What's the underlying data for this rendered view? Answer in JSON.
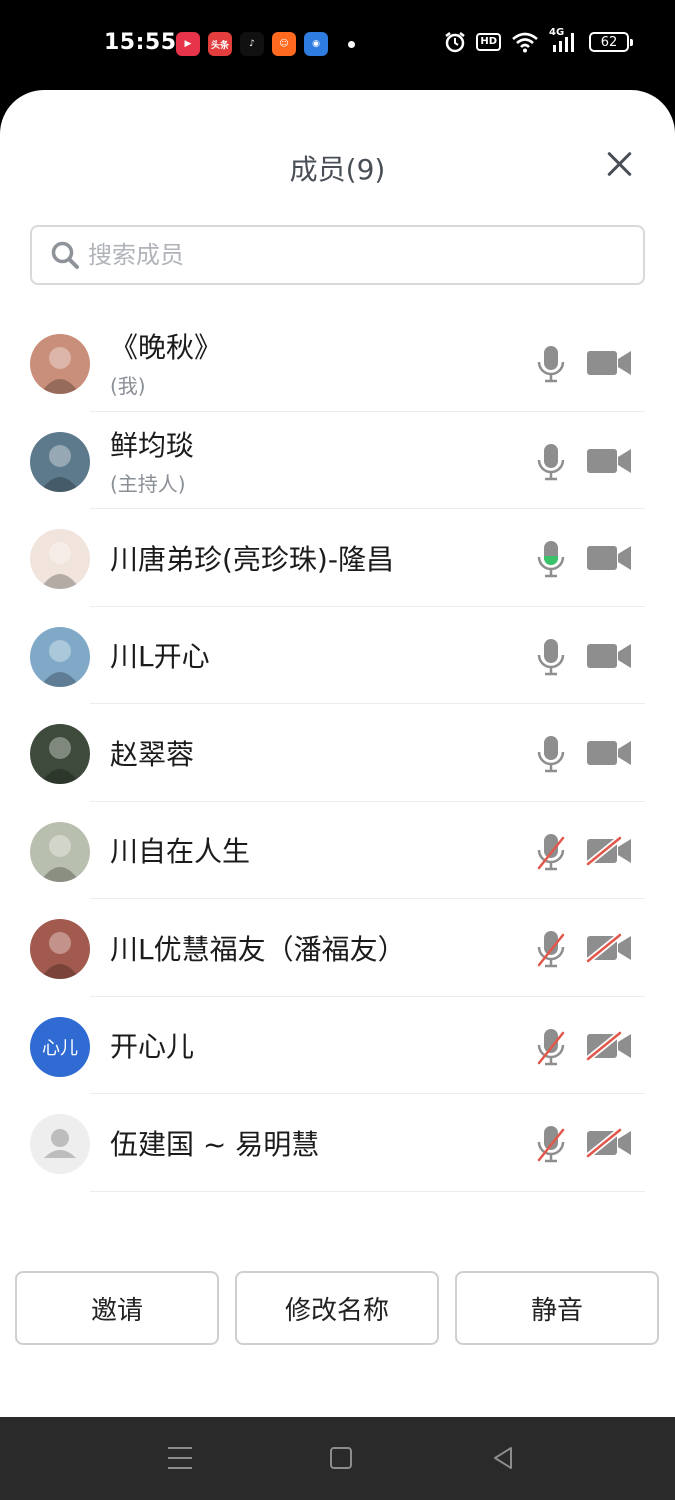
{
  "status_bar": {
    "time": "15:55",
    "apps": [
      {
        "name": "video-app-icon",
        "color": "#e8344a",
        "glyph": "▶"
      },
      {
        "name": "toutiao-app-icon",
        "color": "#e33e3e",
        "glyph": "头条"
      },
      {
        "name": "tiktok-app-icon",
        "color": "#111111",
        "glyph": "♪"
      },
      {
        "name": "kuaishou-app-icon",
        "color": "#ff6a1f",
        "glyph": "☺"
      },
      {
        "name": "meeting-app-icon",
        "color": "#2f7ce0",
        "glyph": "◉"
      }
    ],
    "hd": "HD",
    "network": "4G",
    "battery": "62"
  },
  "sheet": {
    "title": "成员(9)",
    "search_placeholder": "搜索成员"
  },
  "members": [
    {
      "name": "《晚秋》",
      "role": "(我)",
      "avatar": "photo",
      "avatar_color": "#c98f7a",
      "mic": "on",
      "cam": "on"
    },
    {
      "name": "鲜均琰",
      "role": "(主持人)",
      "avatar": "photo",
      "avatar_color": "#5d7a8c",
      "mic": "on",
      "cam": "on"
    },
    {
      "name": "川唐弟珍(亮珍珠)-隆昌",
      "role": "",
      "avatar": "photo",
      "avatar_color": "#f1e4dd",
      "mic": "speaking",
      "cam": "on"
    },
    {
      "name": "川L开心",
      "role": "",
      "avatar": "photo",
      "avatar_color": "#7fa9c7",
      "mic": "on",
      "cam": "on"
    },
    {
      "name": "赵翠蓉",
      "role": "",
      "avatar": "photo",
      "avatar_color": "#3e4a3b",
      "mic": "on",
      "cam": "on"
    },
    {
      "name": "川自在人生",
      "role": "",
      "avatar": "photo",
      "avatar_color": "#b9bfae",
      "mic": "off",
      "cam": "off"
    },
    {
      "name": "川L优慧福友（潘福友）",
      "role": "",
      "avatar": "photo",
      "avatar_color": "#a35a4e",
      "mic": "off",
      "cam": "off"
    },
    {
      "name": "开心儿",
      "role": "",
      "avatar": "text",
      "avatar_text": "心儿",
      "avatar_color": "#2f6bd2",
      "mic": "off",
      "cam": "off"
    },
    {
      "name": "伍建国 ~ 易明慧",
      "role": "",
      "avatar": "blank",
      "avatar_color": "#eeeeee",
      "mic": "off",
      "cam": "off"
    }
  ],
  "actions": {
    "invite": "邀请",
    "rename": "修改名称",
    "mute": "静音"
  },
  "colors": {
    "icon_gray": "#8e8e8e",
    "muted_red": "#e2574c",
    "speaking_green": "#3ac26a"
  }
}
